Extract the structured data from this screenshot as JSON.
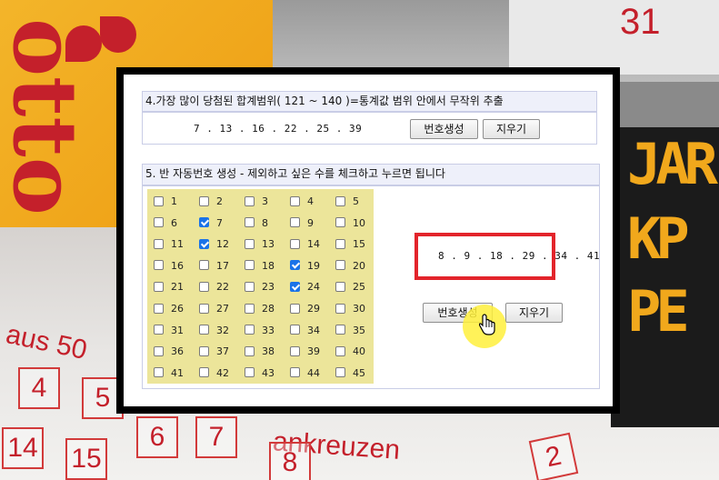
{
  "background": {
    "logo_text": "otto",
    "calendar_number": "31",
    "led_text": [
      "JAR",
      "KP",
      "PE"
    ],
    "aus_text": "aus 50",
    "kreuzen_text": "ankreuzen",
    "slip_numbers": [
      "4",
      "5",
      "6",
      "7",
      "14",
      "15",
      "8",
      "2"
    ]
  },
  "section4": {
    "title": "4.가장 많이 당첨된 합계범위( 121 ~ 140 )=통계값 범위 안에서 무작위 추출",
    "result": "7 . 13 . 16 . 22 . 25 . 39",
    "generate_label": "번호생성",
    "clear_label": "지우기"
  },
  "section5": {
    "title": "5. 반 자동번호 생성 - 제외하고 싶은 수를 체크하고 누르면 됩니다",
    "numbers": [
      1,
      2,
      3,
      4,
      5,
      6,
      7,
      8,
      9,
      10,
      11,
      12,
      13,
      14,
      15,
      16,
      17,
      18,
      19,
      20,
      21,
      22,
      23,
      24,
      25,
      26,
      27,
      28,
      29,
      30,
      31,
      32,
      33,
      34,
      35,
      36,
      37,
      38,
      39,
      40,
      41,
      42,
      43,
      44,
      45
    ],
    "checked": [
      7,
      12,
      19,
      24
    ],
    "result": "8 . 9 . 18 . 29 . 34 . 41",
    "generate_label": "번호생성",
    "clear_label": "지우기"
  },
  "colors": {
    "grid_bg": "#ece59a",
    "highlight_box": "#e3242b",
    "cursor_highlight": "#fff03c",
    "header_bg": "#eef0fa"
  }
}
